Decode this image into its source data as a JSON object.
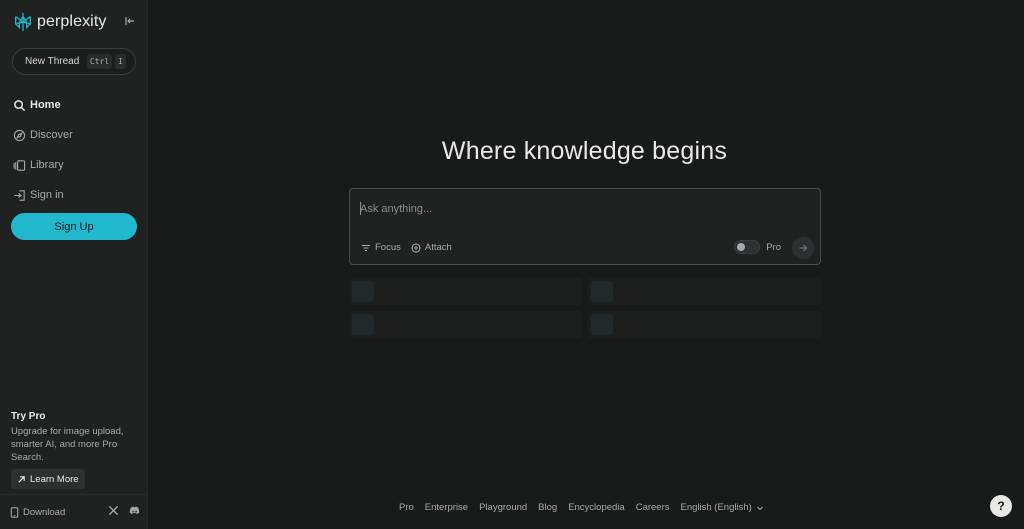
{
  "brand": {
    "name": "perplexity",
    "accent": "#21b8cd"
  },
  "sidebar": {
    "new_thread": {
      "label": "New Thread",
      "keys": [
        "Ctrl",
        "I"
      ]
    },
    "nav": [
      {
        "label": "Home",
        "icon": "search-icon",
        "active": true
      },
      {
        "label": "Discover",
        "icon": "compass-icon",
        "active": false
      },
      {
        "label": "Library",
        "icon": "library-icon",
        "active": false
      },
      {
        "label": "Sign in",
        "icon": "sign-in-icon",
        "active": false
      }
    ],
    "signup_label": "Sign Up",
    "try_pro": {
      "title": "Try Pro",
      "description": "Upgrade for image upload, smarter AI, and more Pro Search.",
      "learn_more": "Learn More"
    },
    "footer": {
      "download": "Download"
    }
  },
  "main": {
    "headline": "Where knowledge begins",
    "search": {
      "placeholder": "Ask anything...",
      "focus_label": "Focus",
      "attach_label": "Attach",
      "pro_label": "Pro",
      "pro_enabled": false
    },
    "footer_links": [
      "Pro",
      "Enterprise",
      "Playground",
      "Blog",
      "Encyclopedia",
      "Careers",
      "English (English)"
    ],
    "help_label": "?"
  }
}
